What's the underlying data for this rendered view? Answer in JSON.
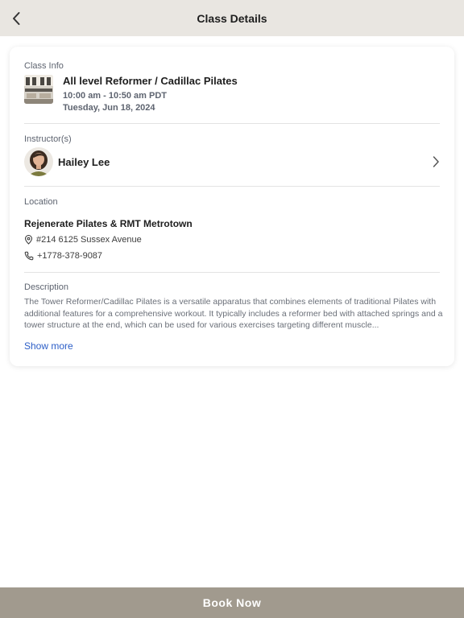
{
  "header": {
    "title": "Class Details",
    "back_icon": "chevron-left-icon"
  },
  "class_info": {
    "label": "Class Info",
    "name": "All level Reformer / Cadillac Pilates",
    "time": "10:00 am - 10:50 am PDT",
    "date": "Tuesday, Jun 18, 2024"
  },
  "instructors": {
    "label": "Instructor(s)",
    "items": [
      {
        "name": "Hailey Lee"
      }
    ]
  },
  "location": {
    "label": "Location",
    "name": "Rejenerate Pilates & RMT Metrotown",
    "address": "#214 6125 Sussex Avenue",
    "phone": "+1778-378-9087",
    "address_icon": "map-pin-icon",
    "phone_icon": "phone-icon"
  },
  "description": {
    "label": "Description",
    "text": "The Tower Reformer/Cadillac Pilates is a versatile apparatus that combines elements of traditional Pilates with additional features for a comprehensive workout. It typically includes a reformer bed with attached springs and a tower structure at the end, which can be used for various exercises targeting different muscle...",
    "show_more": "Show more"
  },
  "footer": {
    "book_label": "Book Now"
  },
  "colors": {
    "header_bg": "#e9e6e1",
    "button_bg": "#a19a8e",
    "link": "#2c5ec7"
  }
}
